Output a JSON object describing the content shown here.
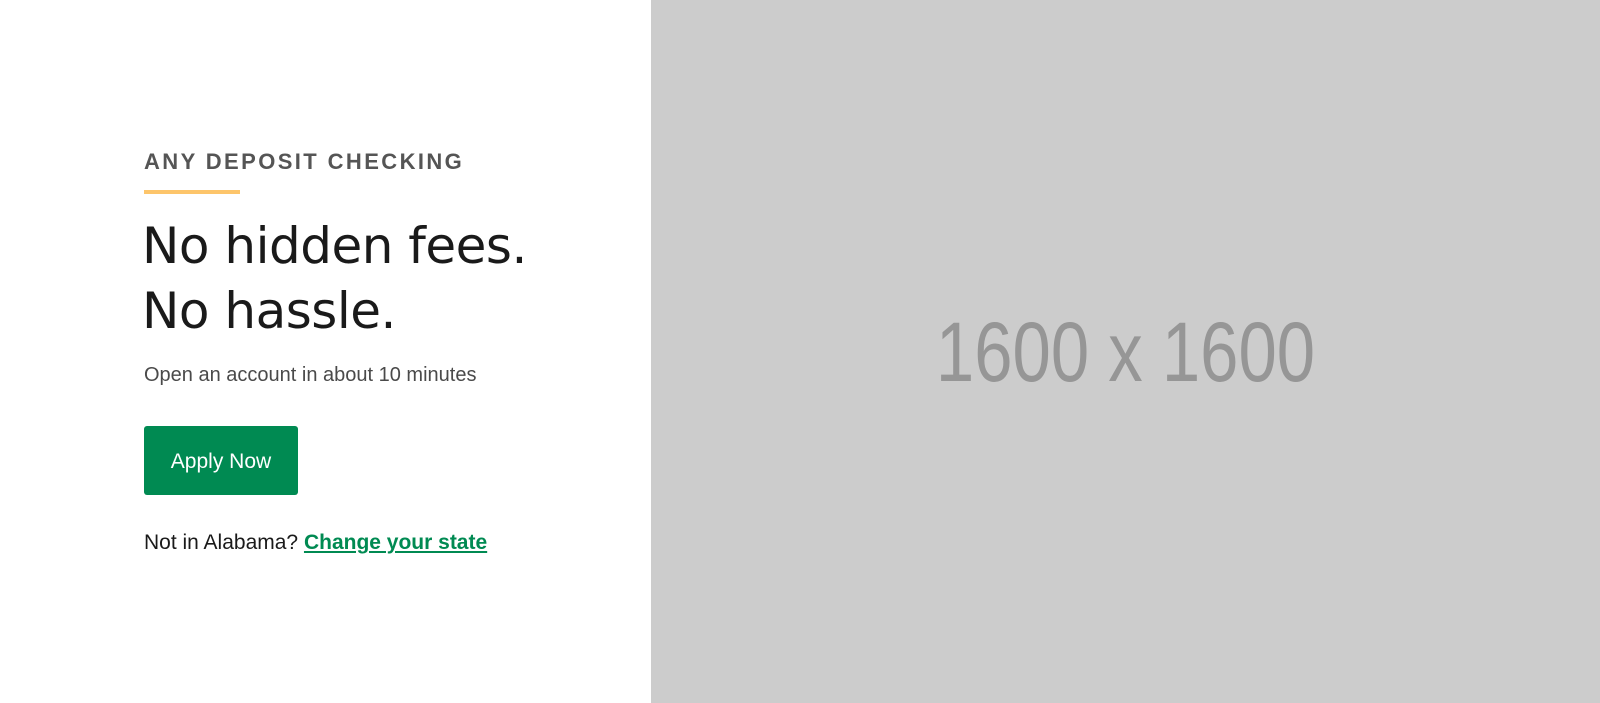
{
  "hero": {
    "eyebrow": "ANY DEPOSIT CHECKING",
    "headline_line1": "No hidden fees.",
    "headline_line2": "No hassle.",
    "subhead": "Open an account in about 10 minutes",
    "apply_button_label": "Apply Now",
    "state_prompt": "Not in Alabama?",
    "state_link_label": "Change your state"
  },
  "image_placeholder": {
    "label": "1600 x 1600"
  },
  "colors": {
    "accent_green": "#008a52",
    "eyebrow_rule": "#fdc56b",
    "placeholder_bg": "#cccccc",
    "placeholder_text": "#969696"
  }
}
